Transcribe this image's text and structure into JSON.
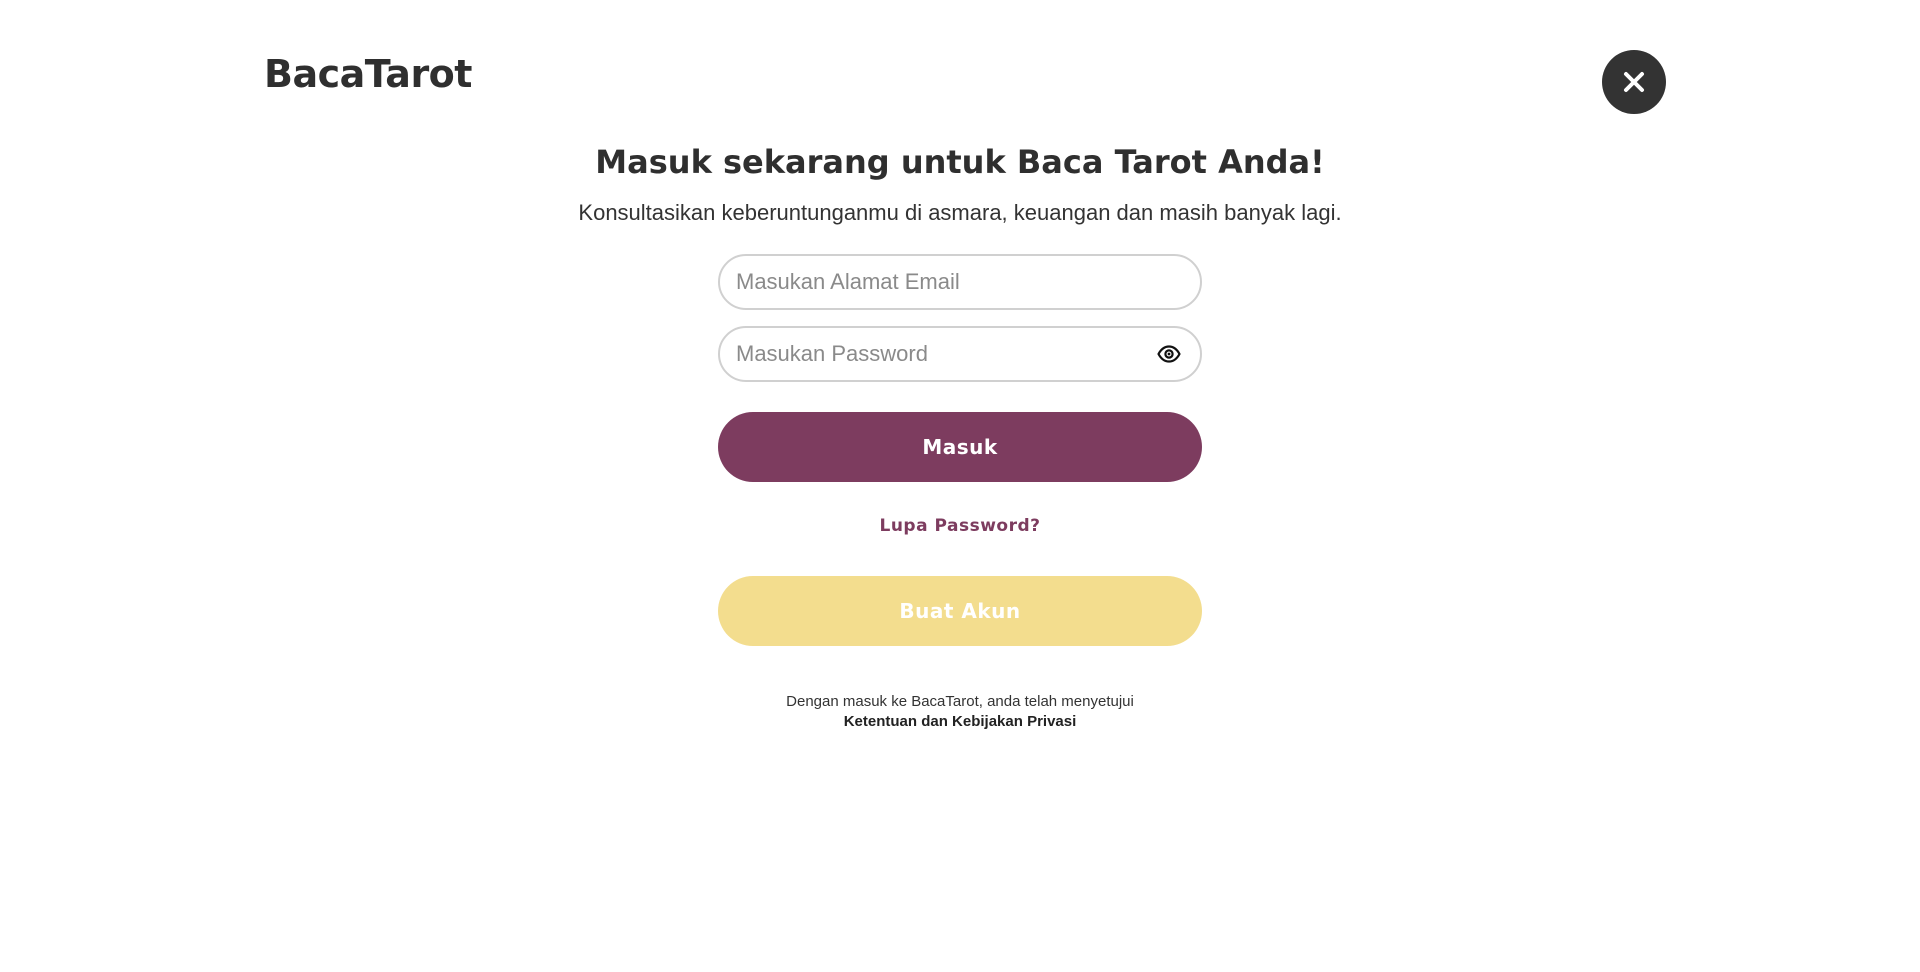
{
  "header": {
    "logo_text": "BacaTarot",
    "close_icon": "close-icon"
  },
  "main": {
    "title": "Masuk sekarang untuk Baca Tarot Anda!",
    "subtitle": "Konsultasikan keberuntunganmu di asmara, keuangan dan masih banyak lagi."
  },
  "form": {
    "email_placeholder": "Masukan Alamat Email",
    "email_value": "",
    "password_placeholder": "Masukan Password",
    "password_value": "",
    "password_toggle_icon": "eye-icon",
    "login_label": "Masuk",
    "forgot_label": "Lupa Password?",
    "register_label": "Buat Akun"
  },
  "footer": {
    "terms_text": "Dengan masuk ke BacaTarot, anda telah menyetujui",
    "terms_link": "Ketentuan dan Kebijakan Privasi"
  },
  "colors": {
    "primary": "#7d3c5f",
    "secondary": "#f3dd8e",
    "close_bg": "#333333",
    "text": "#333333"
  }
}
